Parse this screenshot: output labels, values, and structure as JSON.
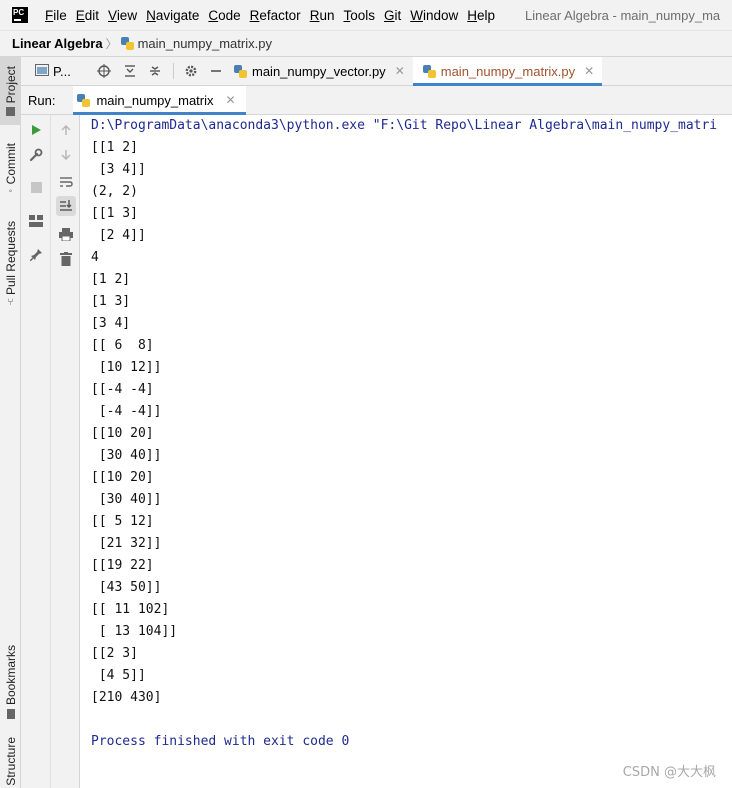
{
  "app": {
    "logo_text": "PC",
    "window_title": "Linear Algebra - main_numpy_ma"
  },
  "menu": [
    {
      "mnemonic": "F",
      "rest": "ile"
    },
    {
      "mnemonic": "E",
      "rest": "dit"
    },
    {
      "mnemonic": "V",
      "rest": "iew"
    },
    {
      "mnemonic": "N",
      "rest": "avigate"
    },
    {
      "mnemonic": "C",
      "rest": "ode"
    },
    {
      "mnemonic": "R",
      "rest": "efactor"
    },
    {
      "mnemonic": "R",
      "rest": "un"
    },
    {
      "mnemonic": "T",
      "rest": "ools"
    },
    {
      "mnemonic": "G",
      "rest": "it"
    },
    {
      "mnemonic": "W",
      "rest": "indow"
    },
    {
      "mnemonic": "H",
      "rest": "elp"
    }
  ],
  "breadcrumb": {
    "project": "Linear Algebra",
    "separator": "〉",
    "file": "main_numpy_matrix.py"
  },
  "left_stripe": {
    "tabs": [
      "Project",
      "Commit",
      "Pull Requests",
      "Bookmarks",
      "Structure"
    ]
  },
  "project_panel": {
    "title": "P..."
  },
  "editor_tabs": [
    {
      "label": "main_numpy_vector.py",
      "active": false
    },
    {
      "label": "main_numpy_matrix.py",
      "active": true
    }
  ],
  "run": {
    "label": "Run:",
    "tab_label": "main_numpy_matrix"
  },
  "console": {
    "command": "D:\\ProgramData\\anaconda3\\python.exe \"F:\\Git Repo\\Linear Algebra\\main_numpy_matri",
    "output": [
      "[[1 2]",
      " [3 4]]",
      "(2, 2)",
      "[[1 3]",
      " [2 4]]",
      "4",
      "[1 2]",
      "[1 3]",
      "[3 4]",
      "[[ 6  8]",
      " [10 12]]",
      "[[-4 -4]",
      " [-4 -4]]",
      "[[10 20]",
      " [30 40]]",
      "[[10 20]",
      " [30 40]]",
      "[[ 5 12]",
      " [21 32]]",
      "[[19 22]",
      " [43 50]]",
      "[[ 11 102]",
      " [ 13 104]]",
      "[[2 3]",
      " [4 5]]",
      "[210 430]",
      ""
    ],
    "finish": "Process finished with exit code 0"
  },
  "watermark": "CSDN @大大枫",
  "colors": {
    "accent": "#4083c9",
    "console_command": "#1f2a8f",
    "active_tab_text": "#a0522d",
    "run_icon": "#3c9a3c"
  }
}
